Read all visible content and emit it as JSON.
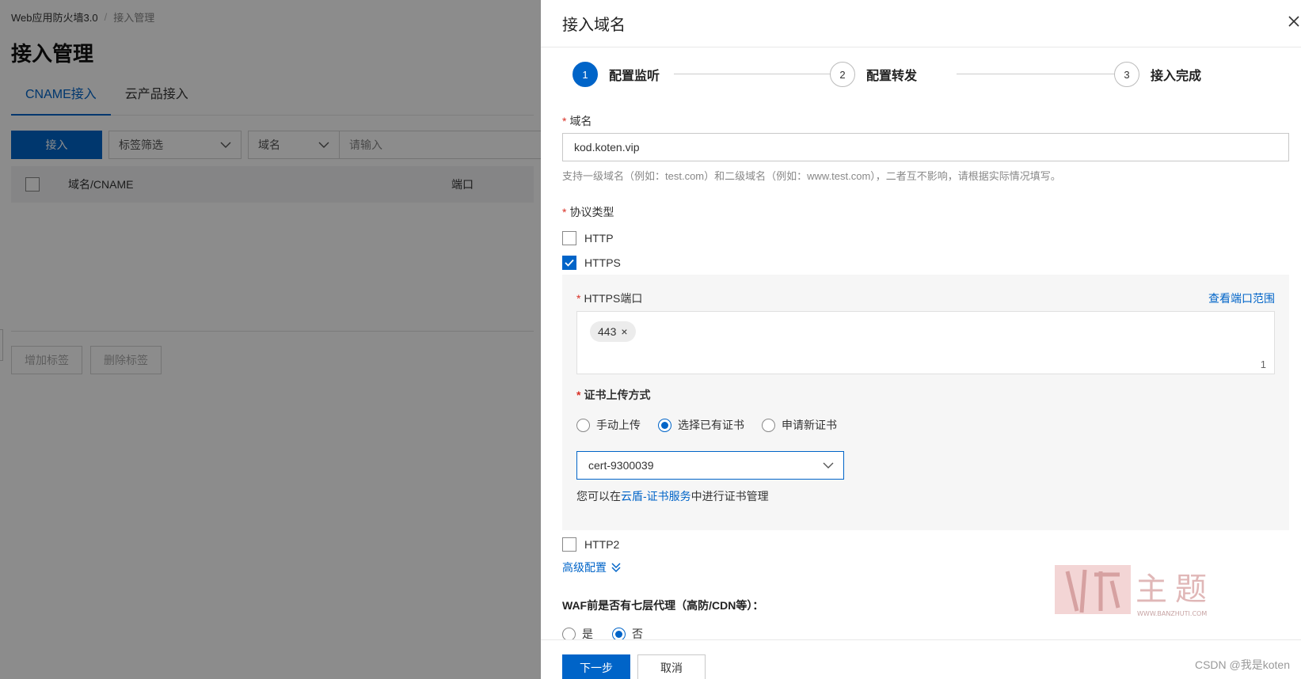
{
  "background": {
    "breadcrumb": [
      "Web应用防火墙3.0",
      "/",
      "接入管理"
    ],
    "page_title": "接入管理",
    "tabs": [
      {
        "label": "CNAME接入",
        "active": true
      },
      {
        "label": "云产品接入",
        "active": false
      }
    ],
    "toolbar": {
      "access_button": "接入",
      "tag_filter": "标签筛选",
      "field_select": "域名",
      "search_placeholder": "请输入"
    },
    "table_columns": [
      "域名/CNAME",
      "端口"
    ],
    "bottom_buttons": [
      "增加标签",
      "删除标签"
    ]
  },
  "drawer": {
    "title": "接入域名",
    "steps": [
      {
        "index": "1",
        "label": "配置监听",
        "active": true
      },
      {
        "index": "2",
        "label": "配置转发",
        "active": false
      },
      {
        "index": "3",
        "label": "接入完成",
        "active": false
      }
    ],
    "domain": {
      "label": "域名",
      "value": "kod.koten.vip",
      "hint": "支持一级域名（例如：test.com）和二级域名（例如：www.test.com），二者互不影响，请根据实际情况填写。"
    },
    "protocol": {
      "label": "协议类型",
      "http": {
        "label": "HTTP",
        "checked": false
      },
      "https": {
        "label": "HTTPS",
        "checked": true
      }
    },
    "https_port": {
      "label": "HTTPS端口",
      "range_link": "查看端口范围",
      "tags": [
        "443"
      ],
      "remove_glyph": "×",
      "count": "1"
    },
    "cert": {
      "label": "证书上传方式",
      "options": [
        {
          "label": "手动上传",
          "selected": false
        },
        {
          "label": "选择已有证书",
          "selected": true
        },
        {
          "label": "申请新证书",
          "selected": false
        }
      ],
      "selected_cert": "cert-9300039",
      "tip_prefix": "您可以在",
      "tip_link": "云盾-证书服务",
      "tip_suffix": "中进行证书管理"
    },
    "http2": {
      "label": "HTTP2",
      "checked": false
    },
    "advanced_link": "高级配置",
    "waf_proxy": {
      "label": "WAF前是否有七层代理（高防/CDN等）：",
      "options": [
        {
          "label": "是",
          "selected": false
        },
        {
          "label": "否",
          "selected": true
        }
      ]
    },
    "footer": {
      "next_button": "下一步",
      "cancel_button": "取消"
    }
  },
  "watermark": {
    "logo_text": "主题",
    "site": "WWW.BANZHUTI.COM"
  },
  "csdn_watermark": "CSDN @我是koten",
  "colors": {
    "primary": "#0064c8",
    "required": "#d93026"
  }
}
